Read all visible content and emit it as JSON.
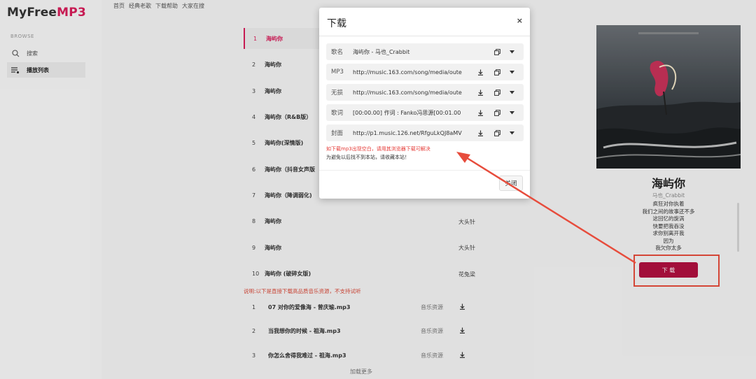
{
  "brand": {
    "logo_prefix": "MyFree",
    "logo_suffix": "MP3"
  },
  "sidebar": {
    "section_label": "BROWSE",
    "items": [
      {
        "label": "搜索",
        "icon": "search-icon"
      },
      {
        "label": "播放列表",
        "icon": "playlist-icon"
      }
    ]
  },
  "topnav": {
    "items": [
      "首页",
      "经典老歌",
      "下载帮助",
      "大家在搜"
    ]
  },
  "tracks": [
    {
      "num": "1",
      "title": "海屿你",
      "artist": ""
    },
    {
      "num": "2",
      "title": "海屿你",
      "artist": ""
    },
    {
      "num": "3",
      "title": "海屿你",
      "artist": ""
    },
    {
      "num": "4",
      "title": "海屿你（R&B版）",
      "artist": ""
    },
    {
      "num": "5",
      "title": "海屿你(深情版)",
      "artist": ""
    },
    {
      "num": "6",
      "title": "海屿你（抖音女声版",
      "artist": ""
    },
    {
      "num": "7",
      "title": "海屿你（降调弱化)",
      "artist": ""
    },
    {
      "num": "8",
      "title": "海屿你",
      "artist": "大头针"
    },
    {
      "num": "9",
      "title": "海屿你",
      "artist": "大头针"
    },
    {
      "num": "10",
      "title": "海屿你 (破碎女版)",
      "artist": "花兔梁"
    }
  ],
  "notice": "说明:以下是直接下载高品质音乐资源，不支持试听",
  "downloads": [
    {
      "num": "1",
      "name": "07 对你的爱像海 - 曾庆瑜.mp3",
      "source": "音乐资源"
    },
    {
      "num": "2",
      "name": "当我想你的时候 - 祖海.mp3",
      "source": "音乐资源"
    },
    {
      "num": "3",
      "name": "你怎么舍得我难过 - 祖海.mp3",
      "source": "音乐资源"
    }
  ],
  "load_more": "加载更多",
  "now_playing": {
    "title": "海屿你",
    "artist": "马也_Crabbit",
    "lyrics": [
      "疯狂对你执着",
      "我们之间的故事还不多",
      "这回忆的旋涡",
      "快要把我吞没",
      "求你别离开我",
      "因为",
      "我欠你太多"
    ],
    "download_button": "下 载"
  },
  "modal": {
    "title": "下载",
    "close_symbol": "×",
    "fields": [
      {
        "label": "歌名",
        "value": "海屿你 - 马也_Crabbit",
        "has_download": false
      },
      {
        "label": "MP3",
        "value": "http://music.163.com/song/media/oute",
        "has_download": true
      },
      {
        "label": "无损",
        "value": "http://music.163.com/song/media/oute",
        "has_download": true
      },
      {
        "label": "歌词",
        "value": "[00:00.00] 作词 : Fanko冯思源[00:01.00",
        "has_download": true
      },
      {
        "label": "封面",
        "value": "http://p1.music.126.net/RfguLkQJ8aMV",
        "has_download": true
      }
    ],
    "warning_red": "如下载mp3出现空白，请用其浏览器下载可解决",
    "warning_black": "为避免以后找不到本站，请收藏本站！",
    "close_button": "关闭"
  },
  "colors": {
    "accent": "#d81e5b",
    "download_button": "#b0103f",
    "annotation": "#e74c3c"
  }
}
